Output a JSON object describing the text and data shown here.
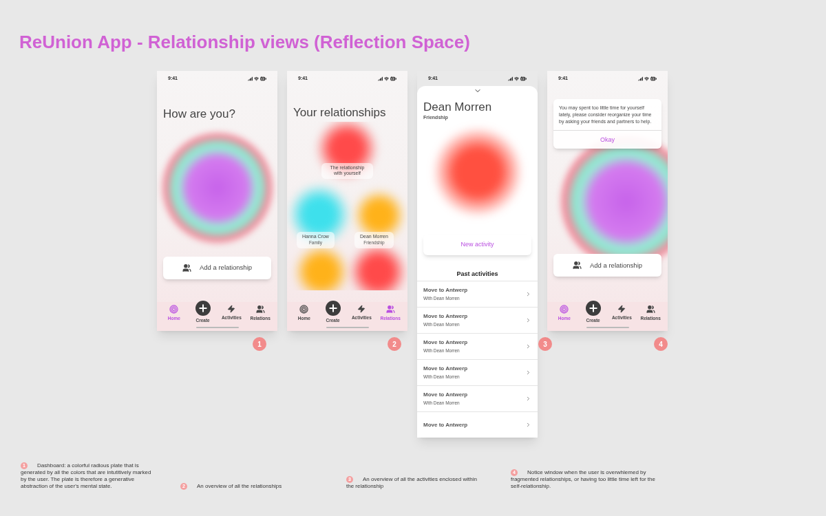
{
  "title": "ReUnion App - Relationship views (Reflection Space)",
  "screens": [
    {
      "kind": "dashboard",
      "number": "1",
      "time": "9:41",
      "heading": "How are you?",
      "action": "Add a relationship",
      "tabs": [
        {
          "kind": "home",
          "label": "Home",
          "selected": true
        },
        {
          "kind": "create",
          "label": "Create",
          "selected": false
        },
        {
          "kind": "activities",
          "label": "Activities",
          "selected": false
        },
        {
          "kind": "relations",
          "label": "Relations",
          "selected": false
        }
      ]
    },
    {
      "kind": "relationships",
      "number": "2",
      "time": "9:41",
      "heading": "Your relationships",
      "relationships": [
        {
          "name": "The relationship with yourself",
          "color": "#ff4a4a"
        },
        {
          "name": "Hanna Crow",
          "type": "Family",
          "color": "#3ee0ec"
        },
        {
          "name": "Dean Morren",
          "type": "Friendship",
          "color": "#ffb21a"
        },
        {
          "color": "#ffb21a"
        },
        {
          "color": "#ff4a4a"
        }
      ],
      "tabs": [
        {
          "kind": "home",
          "label": "Home",
          "selected": false
        },
        {
          "kind": "create",
          "label": "Create",
          "selected": false
        },
        {
          "kind": "activities",
          "label": "Activities",
          "selected": false
        },
        {
          "kind": "relations",
          "label": "Relations",
          "selected": true
        }
      ]
    },
    {
      "kind": "detail",
      "number": "3",
      "time": "9:41",
      "heading": "Dean Morren",
      "subheading": "Friendship",
      "action": "New activity",
      "section": "Past activities",
      "activities": [
        {
          "title": "Move to Antwerp",
          "subtitle": "With Dean Morren"
        },
        {
          "title": "Move to Antwerp",
          "subtitle": "With Dean Morren"
        },
        {
          "title": "Move to Antwerp",
          "subtitle": "With Dean Morren"
        },
        {
          "title": "Move to Antwerp",
          "subtitle": "With Dean Morren"
        },
        {
          "title": "Move to Antwerp",
          "subtitle": "With Dean Morren"
        },
        {
          "title": "Move to Antwerp"
        }
      ]
    },
    {
      "kind": "notice",
      "number": "4",
      "time": "9:41",
      "message": "You may spent too little time for yourself lately, please consider reorganize your time by asking your friends and partners to help.",
      "confirm": "Okay",
      "action": "Add a relationship",
      "tabs": [
        {
          "kind": "home",
          "label": "Home",
          "selected": true
        },
        {
          "kind": "create",
          "label": "Create",
          "selected": false
        },
        {
          "kind": "activities",
          "label": "Activities",
          "selected": false
        },
        {
          "kind": "relations",
          "label": "Relations",
          "selected": false
        }
      ]
    }
  ],
  "notes": [
    {
      "number": "1",
      "text": "Dashboard: a colorful radious plate that is generated by all the colors that are intutitively marked by the user. The plate is therefore a generative abstraction of the user's mental state."
    },
    {
      "number": "2",
      "text": "An overview of all the relationships"
    },
    {
      "number": "3",
      "text": "An overview of all the activities enclosed within the relationship"
    },
    {
      "number": "4",
      "text": "Notice window when the user is overwhlemed by fragmented relationships, or having too little time left for the self-relationship."
    }
  ]
}
